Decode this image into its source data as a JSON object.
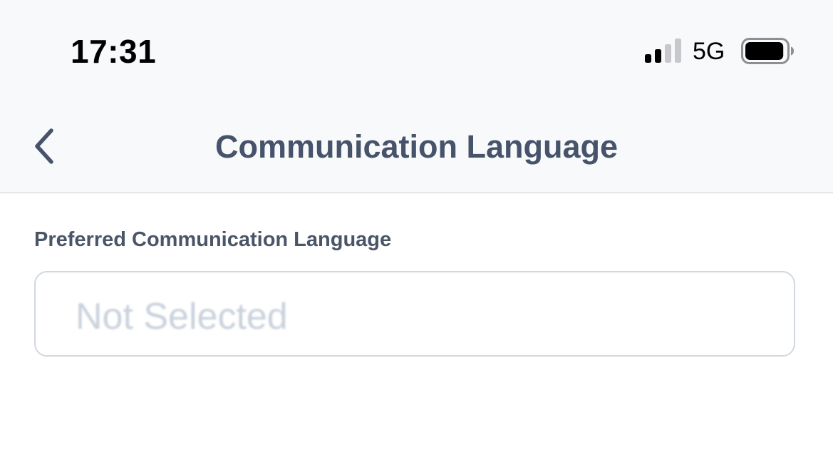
{
  "status_bar": {
    "time": "17:31",
    "network": "5G",
    "signal_icon": "signal-bars-icon",
    "signal_strength_bars": 2,
    "signal_total_bars": 4,
    "battery_icon": "battery-icon",
    "battery_level": 0.95
  },
  "nav_bar": {
    "back_icon": "chevron-left-icon",
    "title": "Communication Language"
  },
  "form": {
    "language_field": {
      "label": "Preferred Communication Language",
      "placeholder": "Not Selected"
    }
  },
  "colors": {
    "header_background": "#f8f9fb",
    "title_text": "#46536a",
    "label_text": "#4a5568",
    "placeholder_text": "#c9d1dc",
    "field_border": "#d2d8df",
    "divider": "#c7cbd1"
  }
}
